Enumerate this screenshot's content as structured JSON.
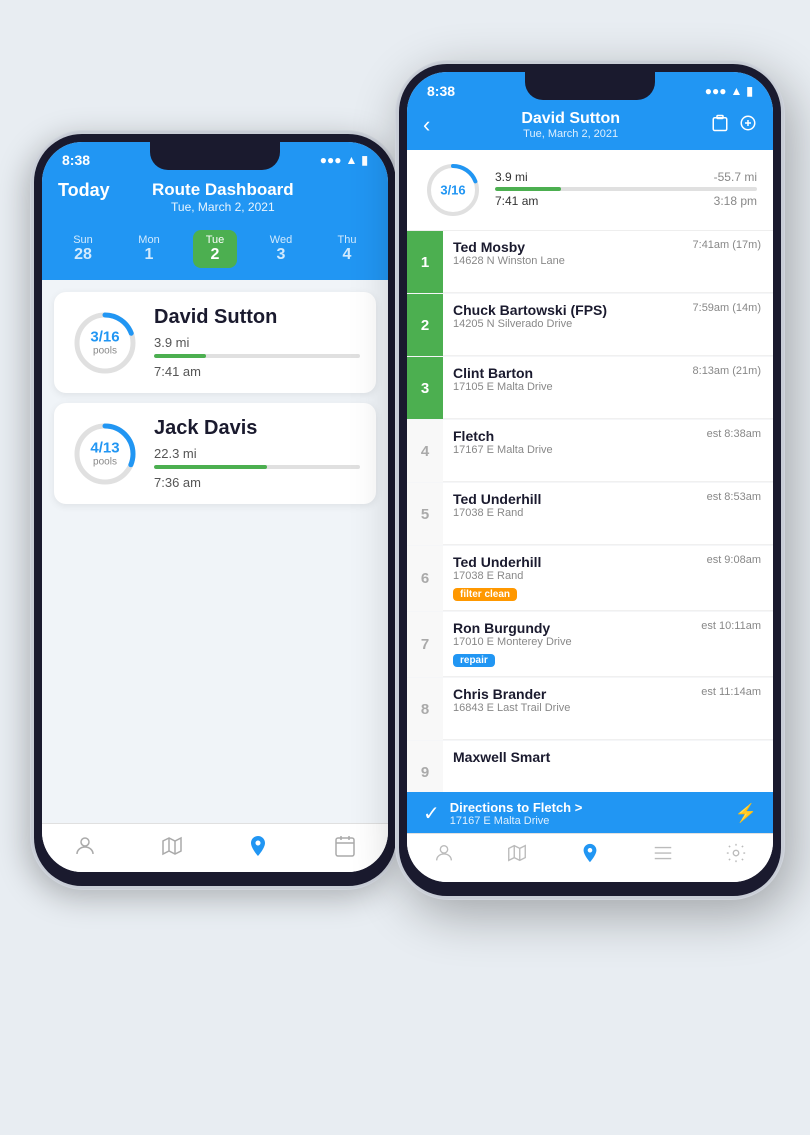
{
  "phone1": {
    "status_time": "8:38",
    "header": {
      "today": "Today",
      "title": "Route Dashboard",
      "date": "Tue, March 2, 2021"
    },
    "days": [
      {
        "name": "Sun",
        "num": "28",
        "active": false
      },
      {
        "name": "Mon",
        "num": "1",
        "active": false
      },
      {
        "name": "Tue",
        "num": "2",
        "active": true
      },
      {
        "name": "Wed",
        "num": "3",
        "active": false
      },
      {
        "name": "Thu",
        "num": "4",
        "active": false
      }
    ],
    "routes": [
      {
        "fraction": "3/16",
        "unit": "pools",
        "progress": 19,
        "name": "David Sutton",
        "distance": "3.9 mi",
        "dist_pct": 25,
        "time": "7:41 am"
      },
      {
        "fraction": "4/13",
        "unit": "pools",
        "progress": 31,
        "name": "Jack Davis",
        "distance": "22.3 mi",
        "dist_pct": 55,
        "time": "7:36 am"
      }
    ],
    "nav": [
      "person-icon",
      "map-icon",
      "location-icon",
      "calendar-icon"
    ]
  },
  "phone2": {
    "status_time": "8:38",
    "header": {
      "back": "‹",
      "driver_name": "David Sutton",
      "driver_date": "Tue, March 2, 2021"
    },
    "summary": {
      "fraction": "3/16",
      "distance": "3.9 mi",
      "distance_neg": "-55.7 mi",
      "dist_pct": 25,
      "time_start": "7:41 am",
      "time_end": "3:18 pm"
    },
    "stops": [
      {
        "num": "1",
        "done": true,
        "name": "Ted Mosby",
        "address": "14628 N Winston Lane",
        "time": "7:41am (17m)",
        "tag": null
      },
      {
        "num": "2",
        "done": true,
        "name": "Chuck Bartowski (FPS)",
        "address": "14205 N Silverado Drive",
        "time": "7:59am (14m)",
        "tag": null
      },
      {
        "num": "3",
        "done": true,
        "name": "Clint Barton",
        "address": "17105 E Malta Drive",
        "time": "8:13am (21m)",
        "tag": null
      },
      {
        "num": "4",
        "done": false,
        "name": "Fletch",
        "address": "17167 E Malta Drive",
        "time": "est 8:38am",
        "tag": null
      },
      {
        "num": "5",
        "done": false,
        "name": "Ted Underhill",
        "address": "17038 E Rand",
        "time": "est 8:53am",
        "tag": null
      },
      {
        "num": "6",
        "done": false,
        "name": "Ted Underhill",
        "address": "17038 E Rand",
        "time": "est 9:08am",
        "tag": {
          "text": "filter clean",
          "color": "orange"
        }
      },
      {
        "num": "7",
        "done": false,
        "name": "Ron Burgundy",
        "address": "17010 E Monterey Drive",
        "time": "est 10:11am",
        "tag": {
          "text": "repair",
          "color": "blue"
        }
      },
      {
        "num": "8",
        "done": false,
        "name": "Chris Brander",
        "address": "16843 E Last Trail Drive",
        "time": "est 11:14am",
        "tag": null
      },
      {
        "num": "9",
        "done": false,
        "name": "Maxwell Smart",
        "address": "",
        "time": "",
        "tag": null
      }
    ],
    "bottom_bar": {
      "direction_title": "Directions to Fletch >",
      "direction_addr": "17167 E Malta Drive"
    },
    "nav": [
      "person-icon",
      "map-icon",
      "location-icon",
      "list-icon",
      "gear-icon"
    ]
  }
}
